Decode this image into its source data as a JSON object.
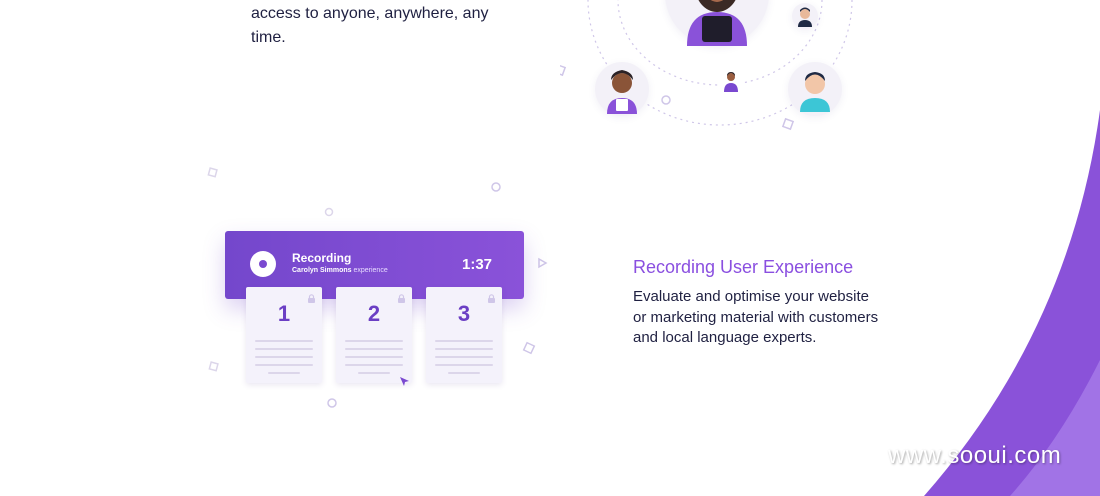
{
  "intro": {
    "line1": "access to anyone, anywhere, any",
    "line2": "time."
  },
  "recording_card": {
    "title": "Recording",
    "subtitle_name": "Carolyn Simmons",
    "subtitle_suffix": "experience",
    "time": "1:37",
    "pages": [
      "1",
      "2",
      "3"
    ]
  },
  "feature": {
    "title": "Recording User Experience",
    "description_lines": [
      "Evaluate and optimise your website",
      "or marketing material with customers",
      "and local language experts."
    ]
  },
  "watermark": "www.sooui.com",
  "colors": {
    "accent": "#8a4fe0",
    "card_purple": "#7447cc",
    "text_dark": "#1f2041",
    "swoosh": "#8a52d9"
  }
}
